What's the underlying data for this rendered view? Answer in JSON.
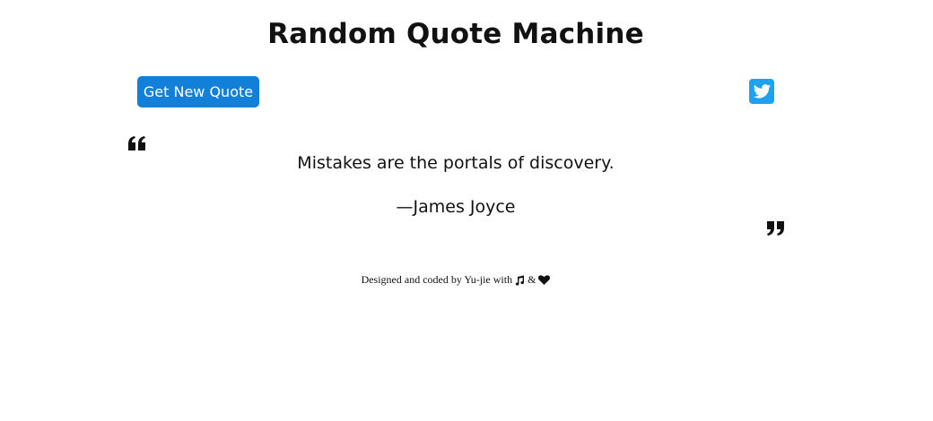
{
  "header": {
    "title": "Random Quote Machine"
  },
  "actions": {
    "new_quote_label": "Get New Quote",
    "tweet_icon": "twitter-icon",
    "tweet_color": "#1da1f2",
    "button_color": "#1280d8"
  },
  "quote": {
    "open_icon": "quote-left-icon",
    "close_icon": "quote-right-icon",
    "text": "Mistakes are the portals of discovery.",
    "author": "—James Joyce"
  },
  "footer": {
    "text_before": "Designed and coded by Yu-jie with",
    "music_icon": "music-icon",
    "separator": "&",
    "heart_icon": "heart-icon"
  }
}
